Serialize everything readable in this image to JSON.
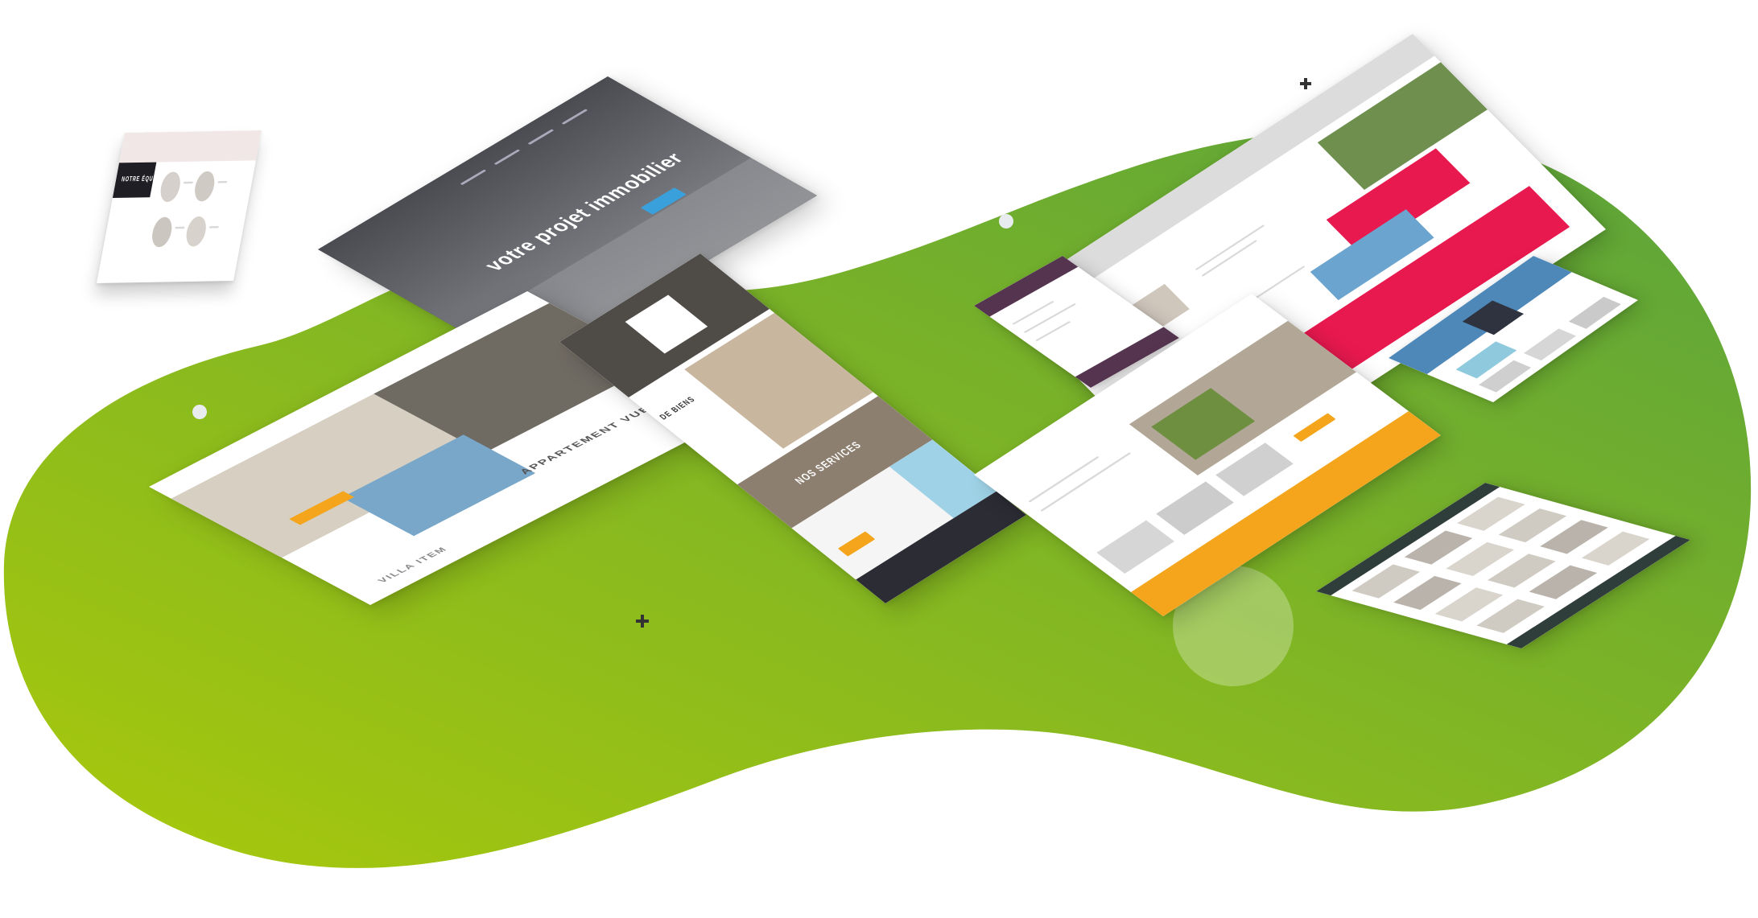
{
  "colors": {
    "blob_light": "#a9c90b",
    "blob_dark": "#5aa33c",
    "accent_pink": "#e8194f",
    "accent_orange": "#f4a51c",
    "accent_blue": "#3aa0dc",
    "accent_purple": "#54344f",
    "accent_slate": "#2f3e3b"
  },
  "mockups": [
    {
      "id": "team",
      "title": "NOTRE ÉQUIPE"
    },
    {
      "id": "hero",
      "title": "votre projet immobilier"
    },
    {
      "id": "listing",
      "title": "APPARTEMENT VUE",
      "subtitle": "VILLA ITEM"
    },
    {
      "id": "services",
      "title": "NOS SERVICES",
      "subtitle": "DE BIENS"
    },
    {
      "id": "pink"
    },
    {
      "id": "purple"
    },
    {
      "id": "orange"
    },
    {
      "id": "blue-small"
    },
    {
      "id": "slate-grid"
    }
  ]
}
